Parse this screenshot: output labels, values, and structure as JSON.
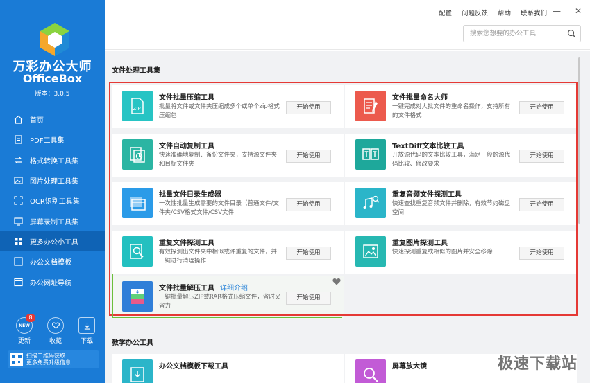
{
  "app": {
    "name_cn": "万彩办公大师",
    "name_en": "OfficeBox",
    "version": "版本：3.0.5"
  },
  "nav": [
    {
      "label": "首页",
      "icon": "home-icon"
    },
    {
      "label": "PDF工具集",
      "icon": "pdf-icon"
    },
    {
      "label": "格式转换工具集",
      "icon": "convert-icon"
    },
    {
      "label": "图片处理工具集",
      "icon": "image-icon"
    },
    {
      "label": "OCR识别工具集",
      "icon": "ocr-icon"
    },
    {
      "label": "屏幕录制工具集",
      "icon": "screen-record-icon"
    },
    {
      "label": "更多办公小工具",
      "icon": "grid-icon",
      "active": true
    },
    {
      "label": "办公文档模板",
      "icon": "template-icon"
    },
    {
      "label": "办公网址导航",
      "icon": "browser-icon"
    }
  ],
  "bottom": {
    "update": {
      "label": "更新",
      "badge": "8",
      "icon_text": "NEW"
    },
    "favorite": {
      "label": "收藏"
    },
    "download": {
      "label": "下载"
    }
  },
  "qr": {
    "line1": "扫描二维码获取",
    "line2": "更多免费升级信息"
  },
  "toplinks": [
    "配置",
    "问题反馈",
    "帮助",
    "联系我们"
  ],
  "window": {
    "minimize": "—",
    "close": "✕"
  },
  "search": {
    "placeholder": "搜索您想要的办公工具"
  },
  "sections": {
    "file": "文件处理工具集",
    "teaching": "教学办公工具"
  },
  "start_label": "开始使用",
  "detail_link": "详细介绍",
  "cards": [
    {
      "title": "文件批量压缩工具",
      "desc": "批量将文件或文件夹压缩成多个或单个zip格式压缩包",
      "color": "#27c4c4",
      "icon": "zip-icon"
    },
    {
      "title": "文件批量命名大师",
      "desc": "一键完成对大批文件的重命名操作，支持所有的文件格式",
      "color": "#ec5a4d",
      "icon": "rename-icon"
    },
    {
      "title": "文件自动复制工具",
      "desc": "快速准确地复制、备份文件夹，支持源文件夹和目标文件夹",
      "color": "#2bb5a3",
      "icon": "copy-clock-icon"
    },
    {
      "title": "TextDiff文本比较工具",
      "desc": "开放源代码的文本比较工具，满足一般的源代码比较、修改要求",
      "color": "#1ea89b",
      "icon": "text-compare-icon"
    },
    {
      "title": "批量文件目录生成器",
      "desc": "一次性批量生成需要的文件目录（普通文件/文件夹/CSV格式文件/CSV文件",
      "color": "#2b9be8",
      "icon": "folder-list-icon"
    },
    {
      "title": "重复音频文件探测工具",
      "desc": "快速查找重复音频文件并删除，有效节约磁盘空间",
      "color": "#2bb5c9",
      "icon": "music-search-icon"
    },
    {
      "title": "重复文件探测工具",
      "desc": "有效探测出文件夹中相似或许重复的文件，并一键进行清理操作",
      "color": "#23c0c0",
      "icon": "file-search-icon"
    },
    {
      "title": "重复图片探测工具",
      "desc": "快速探测重复或相似的图片并安全移除",
      "color": "#27b8b2",
      "icon": "image-search-icon"
    },
    {
      "title": "文件批量解压工具",
      "desc": "一键批量解压ZIP或RAR格式压缩文件，省时又省力",
      "color": "#2f7fd8",
      "icon": "unzip-icon",
      "highlight": true
    },
    {
      "title": "办公文档模板下载工具",
      "desc": "",
      "color": "#2bb5c9",
      "icon": "template-download-icon"
    },
    {
      "title": "屏幕放大镜",
      "desc": "",
      "color": "#c25bd6",
      "icon": "magnifier-icon"
    }
  ],
  "watermark": "极速下载站"
}
